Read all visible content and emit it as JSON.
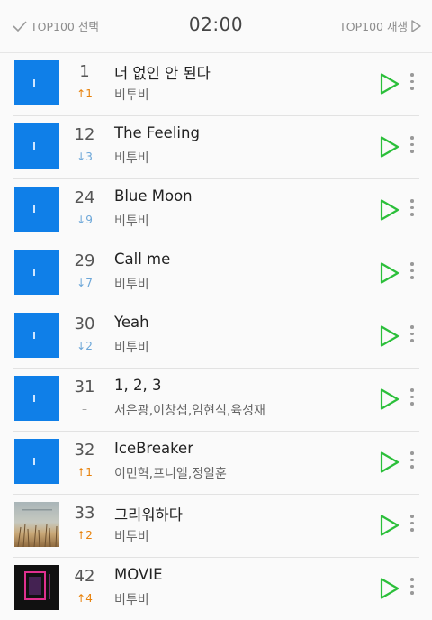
{
  "header": {
    "select_label": "TOP100 선택",
    "timer": "02:00",
    "play_all_label": "TOP100 재생"
  },
  "colors": {
    "accent_green": "#2bbf3a",
    "rank_up": "#e8820c",
    "rank_down": "#6ba6d8",
    "album_blue": "#0f7fe8"
  },
  "songs": [
    {
      "rank": "1",
      "change": "↑1",
      "title": "너 없인 안 된다",
      "artist": "비투비"
    },
    {
      "rank": "12",
      "change": "↓3",
      "title": "The Feeling",
      "artist": "비투비"
    },
    {
      "rank": "24",
      "change": "↓9",
      "title": "Blue Moon",
      "artist": "비투비"
    },
    {
      "rank": "29",
      "change": "↓7",
      "title": "Call me",
      "artist": "비투비"
    },
    {
      "rank": "30",
      "change": "↓2",
      "title": "Yeah",
      "artist": "비투비"
    },
    {
      "rank": "31",
      "change": "–",
      "title": "1, 2, 3",
      "artist": "서은광,이창섭,임현식,육성재"
    },
    {
      "rank": "32",
      "change": "↑1",
      "title": "IceBreaker",
      "artist": "이민혁,프니엘,정일훈"
    },
    {
      "rank": "33",
      "change": "↑2",
      "title": "그리워하다",
      "artist": "비투비"
    },
    {
      "rank": "42",
      "change": "↑4",
      "title": "MOVIE",
      "artist": "비투비"
    }
  ],
  "icons": {
    "select": "check-icon",
    "play_all": "play-outline-icon",
    "row_play": "play-outline-icon",
    "row_more": "more-vertical-icon"
  }
}
